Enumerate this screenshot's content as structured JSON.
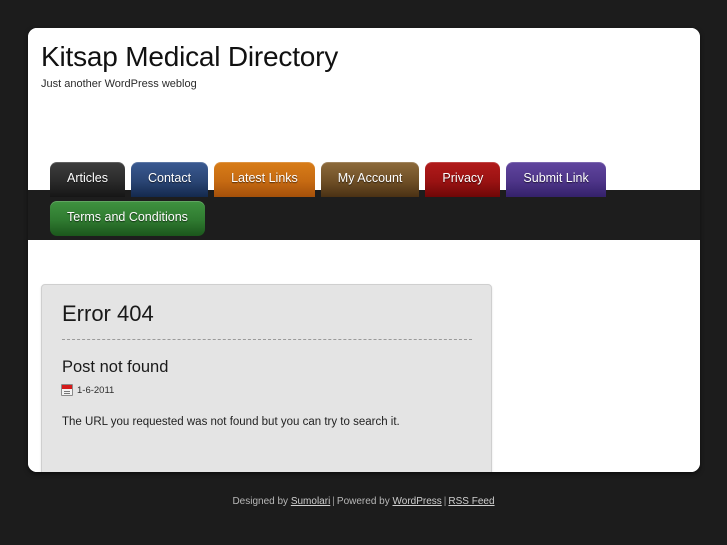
{
  "site": {
    "title": "Kitsap Medical Directory",
    "tagline": "Just another WordPress weblog"
  },
  "nav": {
    "tabs": [
      {
        "label": "Articles",
        "color": "#2a2a2a",
        "row": 1
      },
      {
        "label": "Contact",
        "color": "#2a4574",
        "row": 1
      },
      {
        "label": "Latest Links",
        "color": "#c66a12",
        "row": 1
      },
      {
        "label": "My Account",
        "color": "#6f4f26",
        "row": 1
      },
      {
        "label": "Privacy",
        "color": "#9a1212",
        "row": 1
      },
      {
        "label": "Submit Link",
        "color": "#4e3589",
        "row": 1
      },
      {
        "label": "Terms and Conditions",
        "color": "#2f7a30",
        "row": 2
      }
    ]
  },
  "content": {
    "error_heading": "Error 404",
    "post_title": "Post not found",
    "post_date": "1-6-2011",
    "date_icon": "calendar-icon",
    "body_text": "The URL you requested was not found but you can try to search it."
  },
  "footer": {
    "designed_by_label": "Designed by",
    "designer_link": "Sumolari",
    "separator_1": "|",
    "powered_by_label": "Powered by",
    "platform_link": "WordPress",
    "separator_2": "|",
    "rss_link": "RSS Feed"
  },
  "theme": {
    "page_background": "#1c1c1c",
    "container_background": "#ffffff",
    "nav_band": "#1d1d1d",
    "content_box": "#e4e4e4"
  }
}
